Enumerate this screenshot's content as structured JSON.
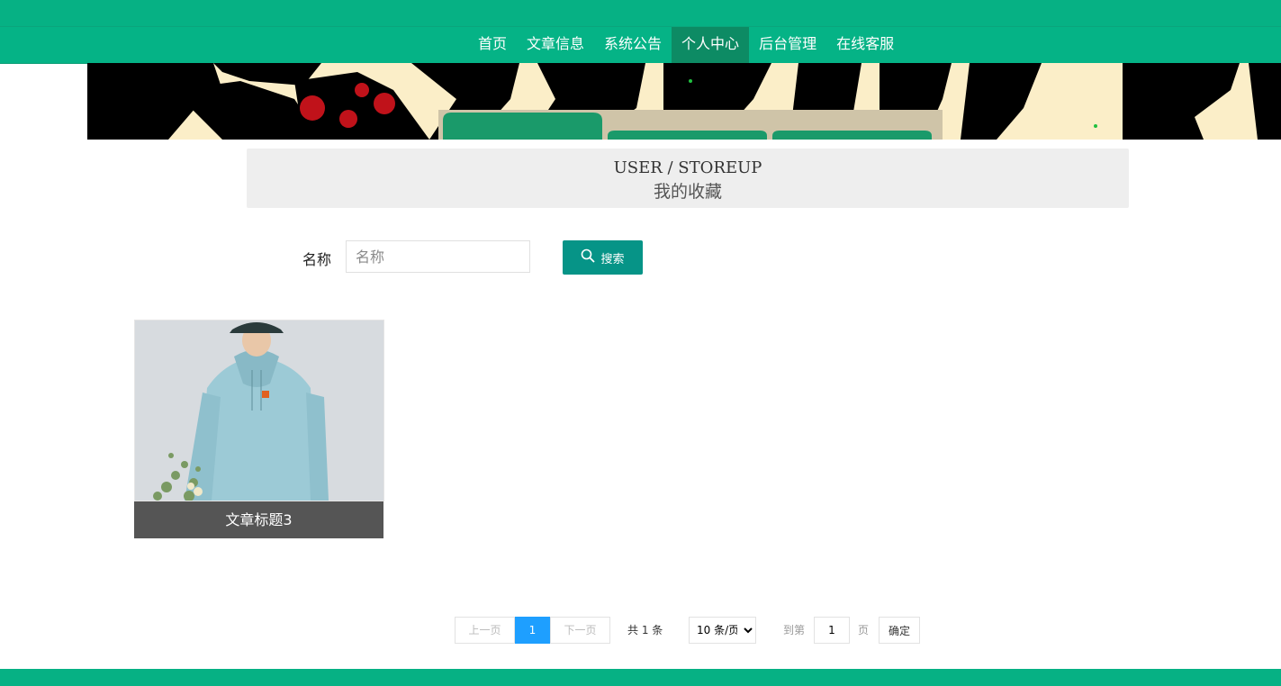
{
  "nav": {
    "items": [
      {
        "label": "首页",
        "active": false
      },
      {
        "label": "文章信息",
        "active": false
      },
      {
        "label": "系统公告",
        "active": false
      },
      {
        "label": "个人中心",
        "active": true
      },
      {
        "label": "后台管理",
        "active": false
      },
      {
        "label": "在线客服",
        "active": false
      }
    ]
  },
  "heading": {
    "en": "USER / STOREUP",
    "cn": "我的收藏"
  },
  "search": {
    "label": "名称",
    "placeholder": "名称",
    "value": "",
    "button_label": "搜索",
    "button_icon": "search-icon"
  },
  "cards": [
    {
      "title": "文章标题3",
      "image": "hoodie-photo"
    }
  ],
  "pagination": {
    "prev_label": "上一页",
    "current_page": "1",
    "next_label": "下一页",
    "total_text": "共 1 条",
    "page_size_selected": "10 条/页",
    "goto_label": "到第",
    "goto_value": "1",
    "page_suffix": "页",
    "confirm_label": "确定"
  },
  "colors": {
    "brand": "#06b184",
    "nav_active": "#0d8b64",
    "search_button": "#069487",
    "page_current": "#1e9fff",
    "caption_bg": "#555555"
  }
}
